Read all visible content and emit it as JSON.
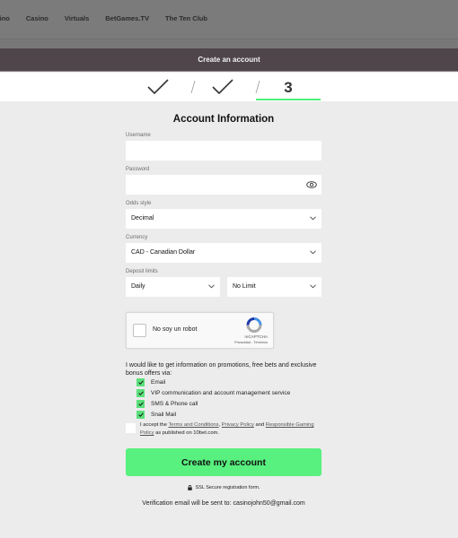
{
  "topnav": {
    "items": [
      "Live casino",
      "Casino",
      "Virtuals",
      "BetGames.TV",
      "The Ten Club"
    ]
  },
  "header": {
    "title": "Create an account"
  },
  "steps": {
    "items": [
      {
        "state": "done",
        "icon": "check-icon"
      },
      {
        "state": "done",
        "icon": "check-icon"
      },
      {
        "state": "current",
        "label": "3"
      }
    ],
    "accent": "#4ef07a"
  },
  "form": {
    "title": "Account Information",
    "username": {
      "label": "Username",
      "value": ""
    },
    "password": {
      "label": "Password",
      "value": "",
      "icon": "eye-icon"
    },
    "odds_style": {
      "label": "Odds style",
      "value": "Decimal"
    },
    "currency": {
      "label": "Currency",
      "value": "CAD - Canadian Dollar"
    },
    "deposit_limits": {
      "label": "Deposit limits",
      "period": "Daily",
      "amount": "No Limit"
    },
    "captcha": {
      "label": "No soy un robot",
      "brand": "reCAPTCHA",
      "links": "Privacidad - Términos"
    },
    "promo_text": "I would like to get information on promotions, free bets and exclusive bonus offers via:",
    "promo_options": [
      {
        "label": "Email",
        "checked": true
      },
      {
        "label": "VIP communication and account management service",
        "checked": true
      },
      {
        "label": "SMS & Phone call",
        "checked": true
      },
      {
        "label": "Snail Mail",
        "checked": true
      }
    ],
    "terms": {
      "prefix": "I accept the ",
      "link1": "Terms and Conditions",
      "sep1": ", ",
      "link2": "Privacy Policy",
      "sep2": " and ",
      "link3": "Responsible Gaming Policy",
      "suffix": " as published on 10bet.com.",
      "checked": false
    },
    "submit_label": "Create my account",
    "ssl_text": "SSL Secure registration form.",
    "verification_text": "Verification email will be sent to: casinojohn50@gmail.com"
  },
  "colors": {
    "accent": "#58f07f",
    "header_bg": "#4f454b",
    "checkbox_green": "#5be07a"
  }
}
